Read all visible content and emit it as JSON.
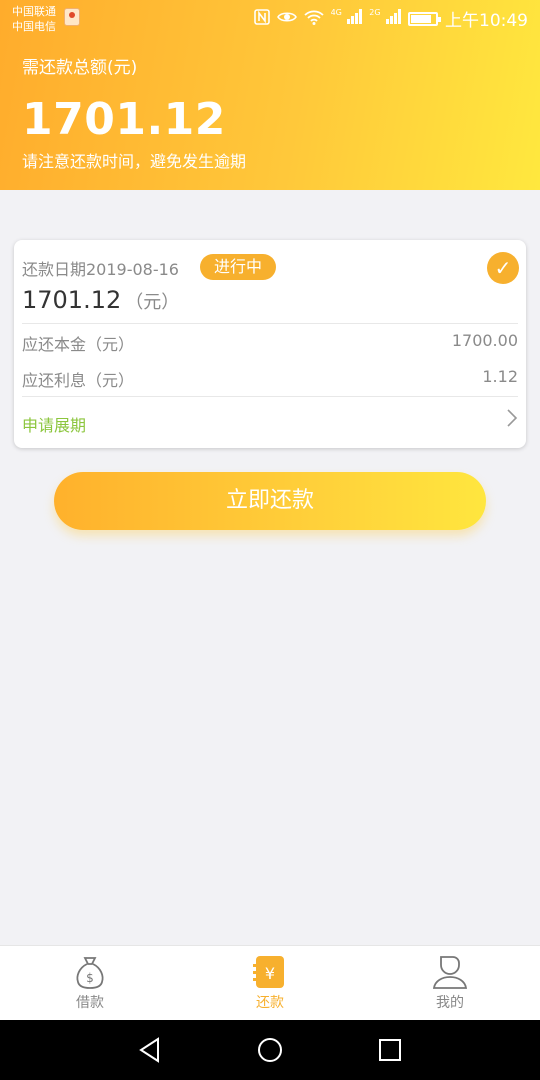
{
  "status_bar": {
    "carrier_1": "中国联通",
    "carrier_2": "中国电信",
    "network_1": "4G",
    "network_2": "2G",
    "time": "上午10:49",
    "icons": [
      "nfc-icon",
      "eye-icon",
      "wifi-icon",
      "signal-icon",
      "battery-icon"
    ]
  },
  "header": {
    "total_label": "需还款总额(元)",
    "total_amount": "1701.12",
    "notice": "请注意还款时间，避免发生逾期"
  },
  "card": {
    "due_date": "还款日期2019-08-16",
    "status_badge": "进行中",
    "amount": "1701.12",
    "amount_unit": "（元）",
    "principal_label": "应还本金（元）",
    "principal_value": "1700.00",
    "interest_label": "应还利息（元）",
    "interest_value": "1.12",
    "extend_label": "申请展期"
  },
  "actions": {
    "repay_now": "立即还款"
  },
  "tabbar": {
    "tabs": [
      {
        "label": "借款",
        "icon": "money-bag-icon",
        "active": false
      },
      {
        "label": "还款",
        "icon": "repay-icon",
        "active": true
      },
      {
        "label": "我的",
        "icon": "profile-icon",
        "active": false
      }
    ]
  },
  "colors": {
    "accent": "#f7b02e",
    "header_gradient_start": "#ffac2c",
    "header_gradient_end": "#ffe83e",
    "link_green": "#8cc63e"
  }
}
